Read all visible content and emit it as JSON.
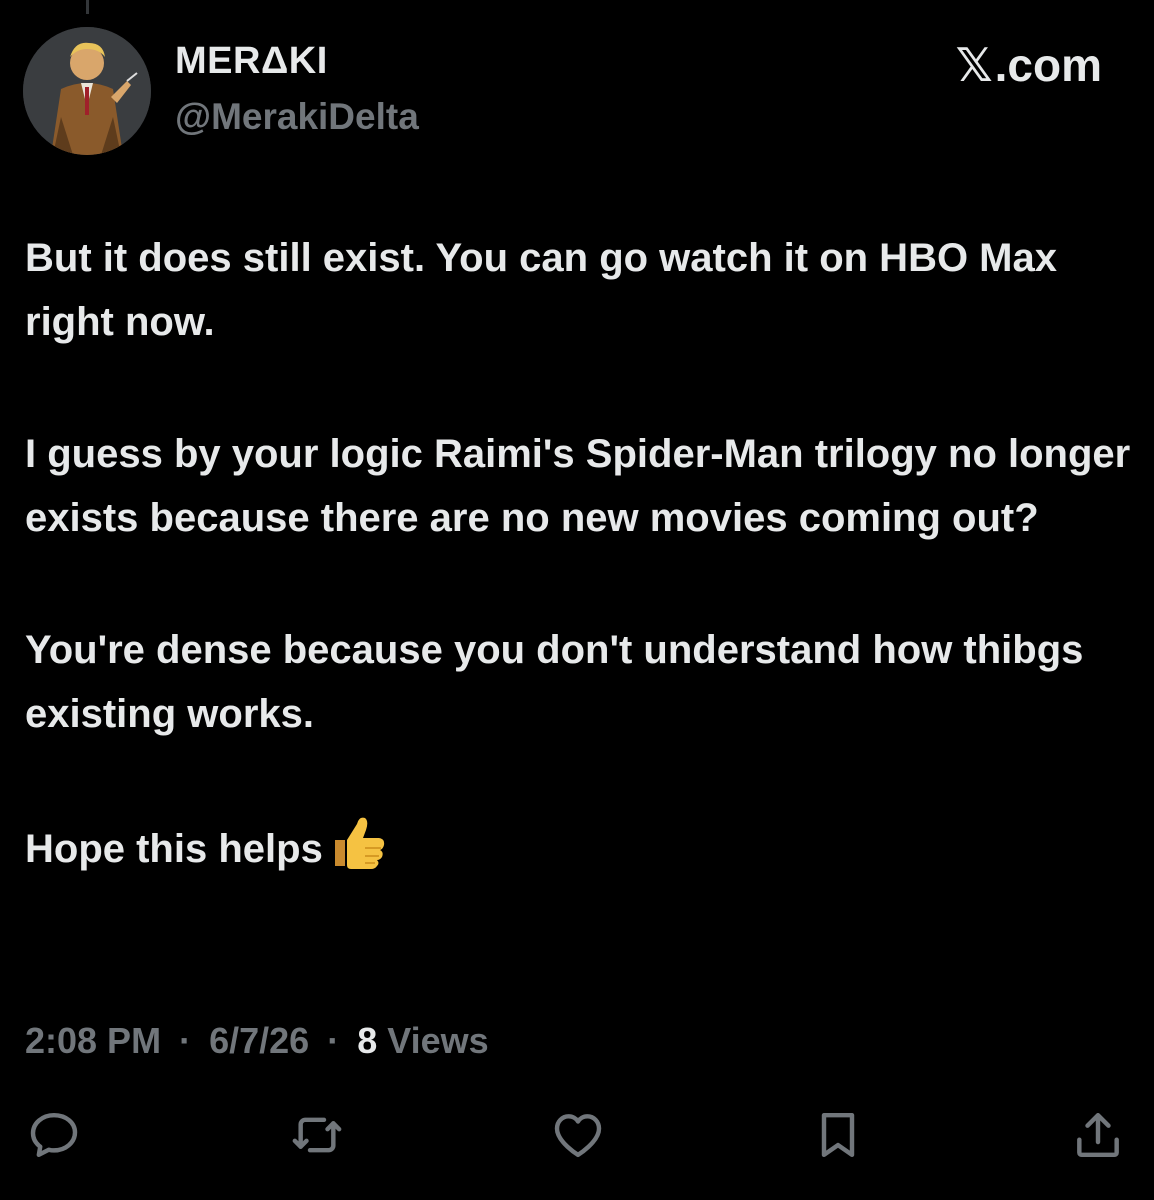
{
  "header": {
    "display_name": "MERΔKI",
    "handle": "@MerakiDelta",
    "brand_text": ".com",
    "brand_icon": "x-logo-icon"
  },
  "tweet": {
    "paragraphs": [
      "But it does still exist. You can go watch it on HBO Max right now.",
      "I guess by your logic Raimi's Spider-Man trilogy no longer exists because there are no new movies coming out?",
      "You're dense because you don't understand how thibgs existing works.",
      "Hope this helps"
    ],
    "emoji": "thumbs-up-icon"
  },
  "meta": {
    "time": "2:08 PM",
    "separator": "·",
    "date": "6/7/26",
    "views_count": "8",
    "views_label": "Views"
  },
  "actions": [
    "reply-icon",
    "retweet-icon",
    "like-icon",
    "bookmark-icon",
    "share-icon"
  ],
  "colors": {
    "background": "#000000",
    "primary_text": "#e7e9ea",
    "secondary_text": "#71767b"
  }
}
